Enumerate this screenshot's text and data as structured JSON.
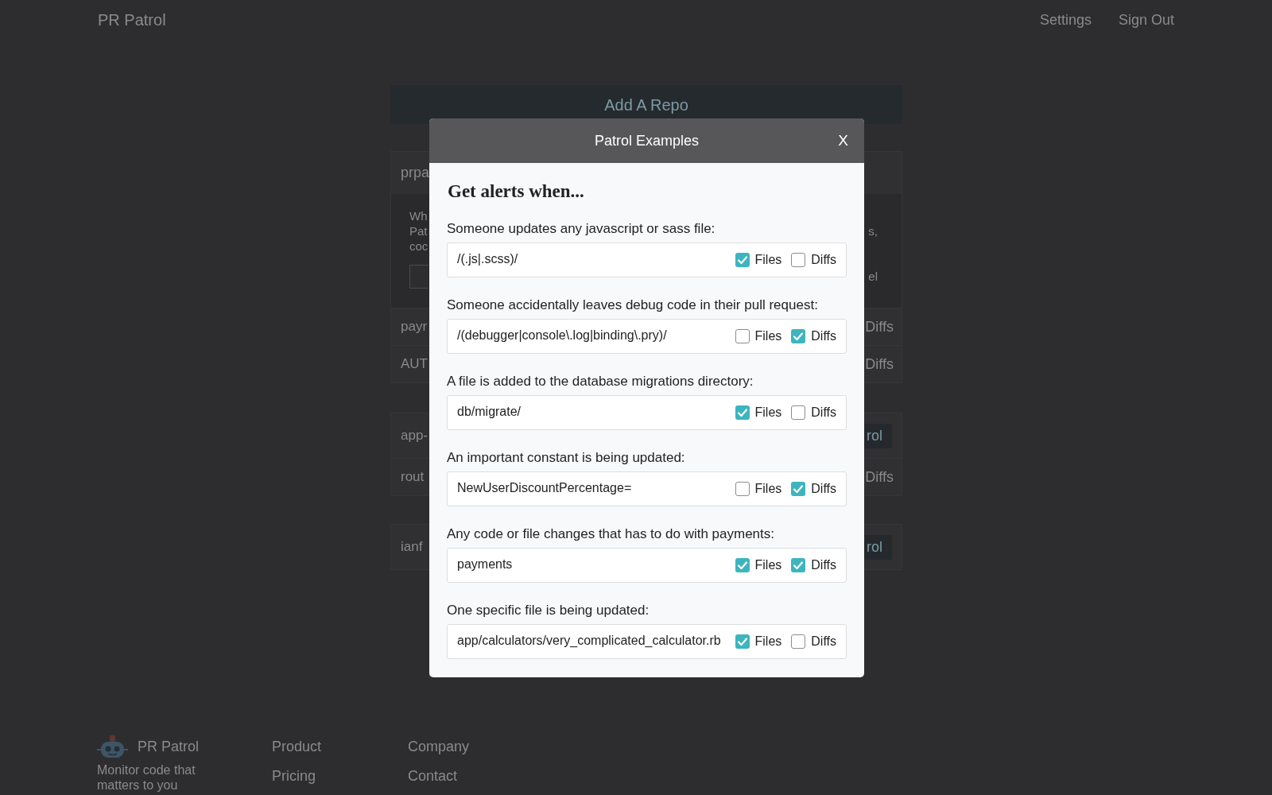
{
  "header": {
    "brand": "PR Patrol",
    "nav": [
      "Settings",
      "Sign Out"
    ]
  },
  "page": {
    "add_repo_button": "Add A Repo",
    "cards": [
      {
        "rows": [
          {
            "kind": "title",
            "left": "prpa"
          },
          {
            "kind": "panel",
            "lines": [
              {
                "left": "Wh"
              },
              {
                "left": "Pat",
                "right": "s,"
              },
              {
                "left": "coc"
              }
            ],
            "field_right": "el"
          },
          {
            "kind": "pattern",
            "left": "payr",
            "right": "Diffs"
          },
          {
            "kind": "pattern",
            "left": "AUT",
            "right": "Diffs"
          }
        ]
      },
      {
        "rows": [
          {
            "kind": "repo",
            "left": "app-",
            "button": "rol"
          },
          {
            "kind": "pattern",
            "left": "rout",
            "right": "Diffs"
          }
        ]
      },
      {
        "rows": [
          {
            "kind": "repo",
            "left": "ianf",
            "button": "rol"
          }
        ]
      }
    ]
  },
  "modal": {
    "title": "Patrol Examples",
    "close": "X",
    "heading": "Get alerts when...",
    "examples": [
      {
        "label": "Someone updates any javascript or sass file:",
        "pattern": "/(.js|.scss)/",
        "options": [
          {
            "label": "Files",
            "checked": true
          },
          {
            "label": "Diffs",
            "checked": false
          }
        ]
      },
      {
        "label": "Someone accidentally leaves debug code in their pull request:",
        "pattern": "/(debugger|console\\.log|binding\\.pry)/",
        "options": [
          {
            "label": "Files",
            "checked": false
          },
          {
            "label": "Diffs",
            "checked": true
          }
        ]
      },
      {
        "label": "A file is added to the database migrations directory:",
        "pattern": "db/migrate/",
        "options": [
          {
            "label": "Files",
            "checked": true
          },
          {
            "label": "Diffs",
            "checked": false
          }
        ]
      },
      {
        "label": "An important constant is being updated:",
        "pattern": "NewUserDiscountPercentage=",
        "options": [
          {
            "label": "Files",
            "checked": false
          },
          {
            "label": "Diffs",
            "checked": true
          }
        ]
      },
      {
        "label": "Any code or file changes that has to do with payments:",
        "pattern": "payments",
        "options": [
          {
            "label": "Files",
            "checked": true
          },
          {
            "label": "Diffs",
            "checked": true
          }
        ]
      },
      {
        "label": "One specific file is being updated:",
        "pattern": "app/calculators/very_complicated_calculator.rb",
        "options": [
          {
            "label": "Files",
            "checked": true
          },
          {
            "label": "Diffs",
            "checked": false
          }
        ]
      }
    ]
  },
  "footer": {
    "brand": "PR Patrol",
    "tagline": "Monitor code that matters to you",
    "columns": [
      {
        "heading": "Product",
        "links": [
          "Pricing"
        ]
      },
      {
        "heading": "Company",
        "links": [
          "Contact"
        ]
      }
    ]
  }
}
